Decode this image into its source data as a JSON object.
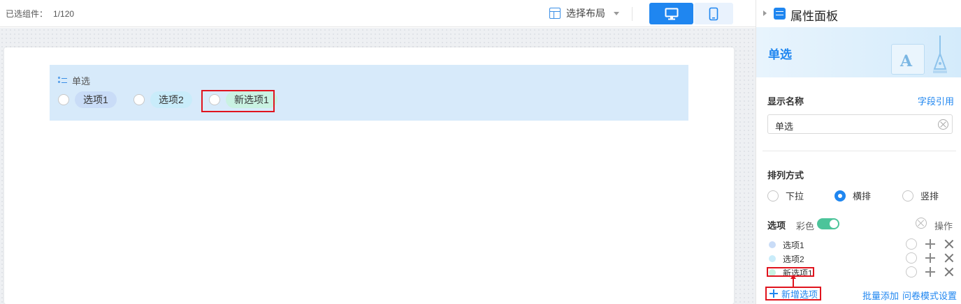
{
  "toolbar": {
    "selected_label": "已选组件：",
    "selected_count": "1/120",
    "layout_label": "选择布局",
    "device_desktop_icon": "desktop-icon",
    "device_mobile_icon": "mobile-icon",
    "accent_color": "#1f86f0"
  },
  "canvas": {
    "field_title": "单选",
    "field_icon": "list-icon",
    "options": [
      "选项1",
      "选项2",
      "新选项1"
    ]
  },
  "panel": {
    "title": "属性面板",
    "component_name": "单选",
    "display_name_label": "显示名称",
    "field_ref_link": "字段引用",
    "display_name_value": "单选",
    "arrange_label": "排列方式",
    "arrange_options": [
      {
        "label": "下拉",
        "checked": false
      },
      {
        "label": "横排",
        "checked": true
      },
      {
        "label": "竖排",
        "checked": false
      }
    ],
    "options_label": "选项",
    "color_label": "彩色",
    "color_on": true,
    "ops_label": "操作",
    "option_rows": [
      {
        "label": "选项1",
        "color": "#c9dcf7"
      },
      {
        "label": "选项2",
        "color": "#c9ecfa"
      },
      {
        "label": "新选项1",
        "color": "#c9f2e2"
      }
    ],
    "add_option": "新增选项",
    "batch_add": "批量添加",
    "survey_mode": "问卷模式设置"
  }
}
